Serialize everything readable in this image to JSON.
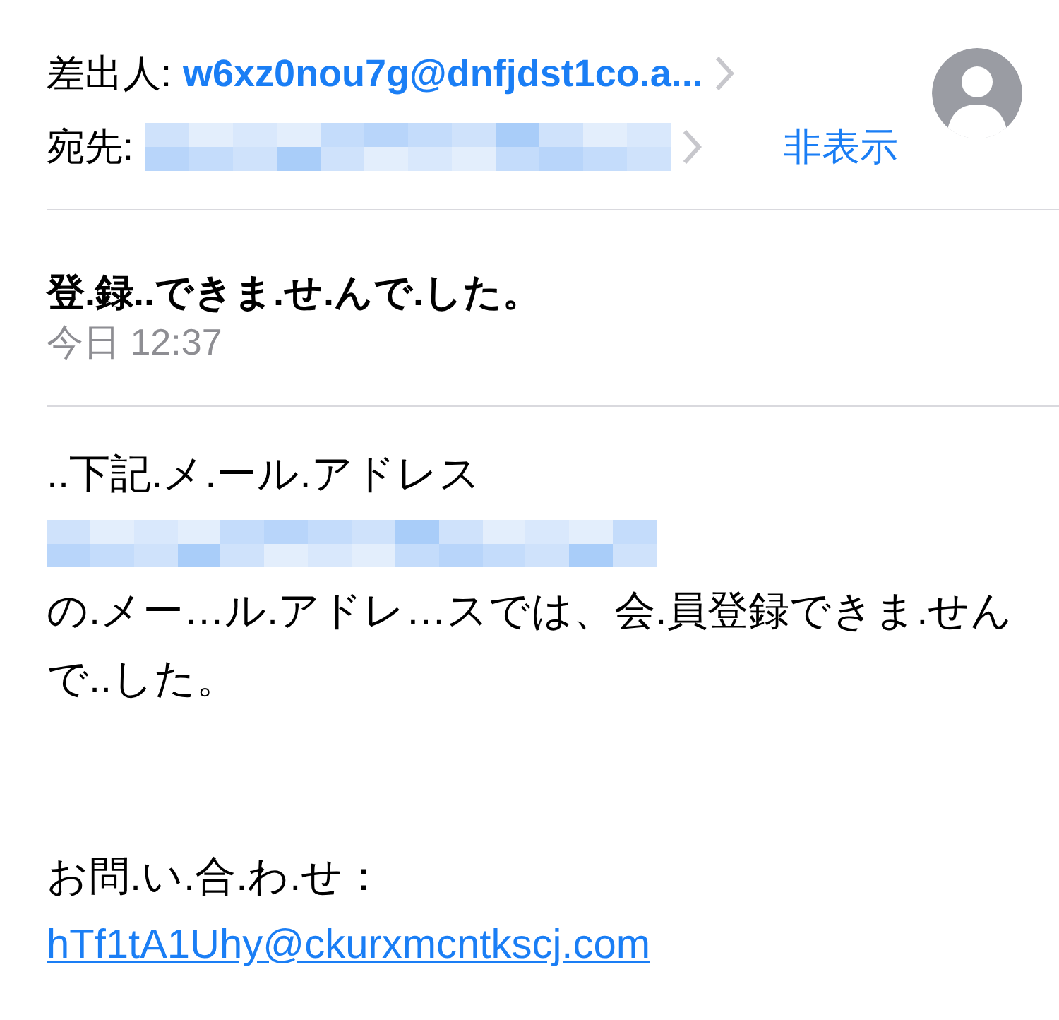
{
  "header": {
    "from_label": "差出人:",
    "from_address": "w6xz0nou7g@dnfjdst1co.a...",
    "to_label": "宛先:",
    "recipient": {
      "kind": "redacted"
    },
    "hide_link": "非表示"
  },
  "message": {
    "subject": "登.録..できま.せ.んで.した。",
    "time": "今日 12:37"
  },
  "body": [
    {
      "kind": "text",
      "text": "..下記.メ.ール.アドレス"
    },
    {
      "kind": "redacted"
    },
    {
      "kind": "text",
      "text": "の.メー…ル.アドレ…スでは、会.員登録できま.せんで..した。"
    },
    {
      "kind": "gap"
    },
    {
      "kind": "text",
      "text": "お問.い.合.わ.せ："
    },
    {
      "kind": "link",
      "text": "hTf1tA1Uhy@ckurxmcntkscj.com"
    }
  ]
}
